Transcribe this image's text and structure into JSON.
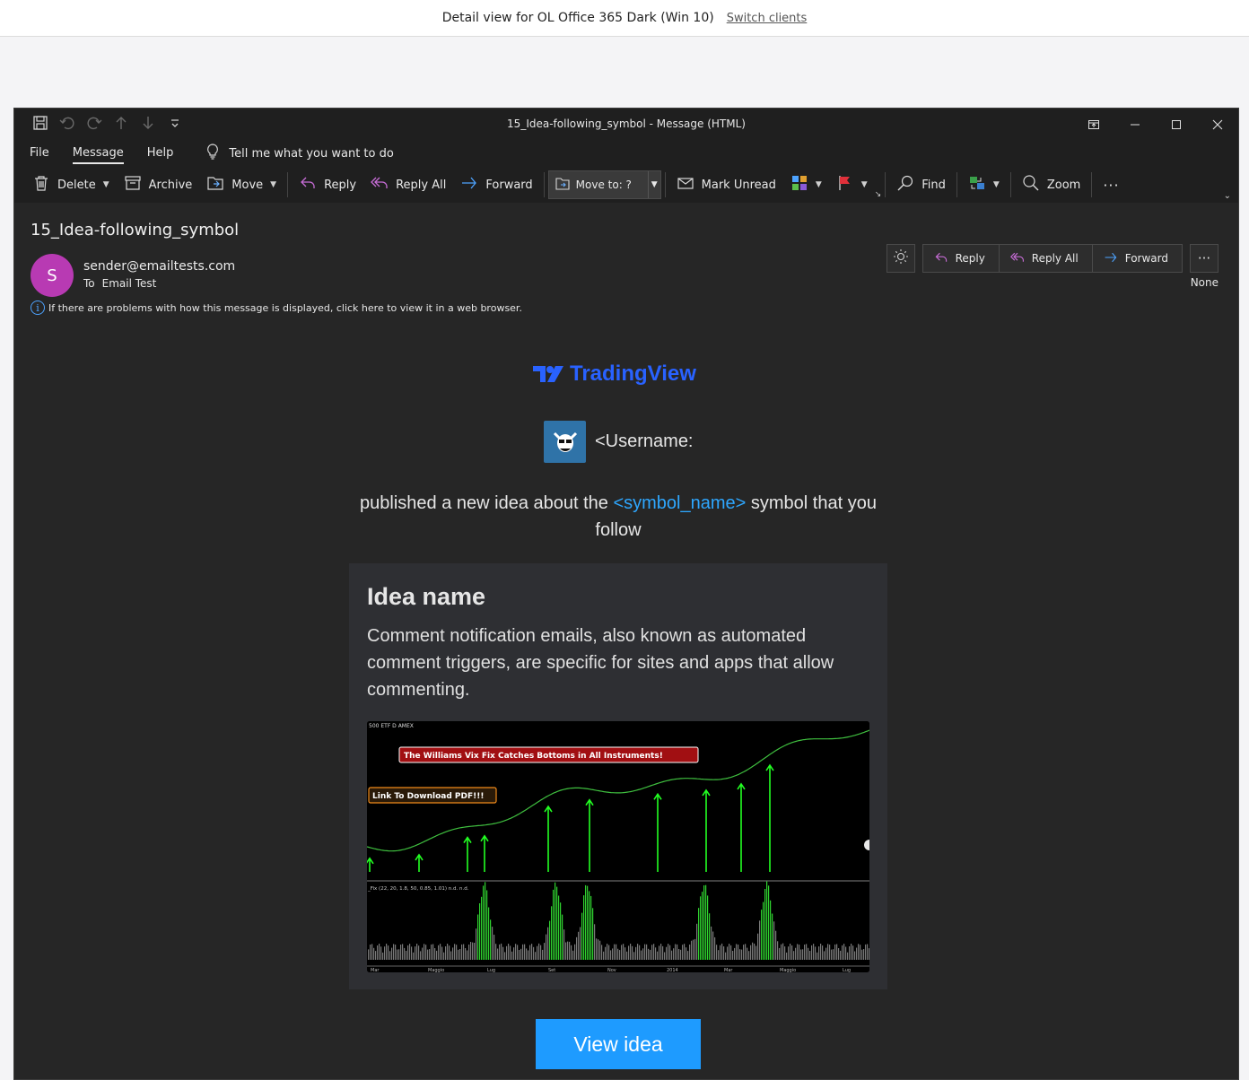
{
  "topbar": {
    "title": "Detail view for OL Office 365 Dark (Win 10)",
    "switch_label": "Switch clients"
  },
  "window": {
    "title": "15_Idea-following_symbol  -  Message (HTML)"
  },
  "menu": {
    "tabs": [
      "File",
      "Message",
      "Help"
    ],
    "active_tab": "Message",
    "tell_me": "Tell me what you want to do"
  },
  "ribbon": {
    "delete": "Delete",
    "archive": "Archive",
    "move": "Move",
    "reply": "Reply",
    "reply_all": "Reply All",
    "forward": "Forward",
    "move_to": "Move to: ?",
    "mark_unread": "Mark Unread",
    "find": "Find",
    "zoom": "Zoom"
  },
  "message": {
    "subject": "15_Idea-following_symbol",
    "avatar_initial": "S",
    "sender": "sender@emailtests.com",
    "to_label": "To",
    "to_value": "Email Test",
    "info": "If there are problems with how this message is displayed, click here to view it in a web browser.",
    "actions": {
      "reply": "Reply",
      "reply_all": "Reply All",
      "forward": "Forward"
    },
    "category": "None"
  },
  "email": {
    "brand": "TradingView",
    "username": "<Username:",
    "published_pre": "published a new idea about the ",
    "symbol": "<symbol_name>",
    "published_post": " symbol that you follow",
    "idea_title": "Idea name",
    "idea_desc": "Comment notification emails, also known as automated comment triggers, are specific for sites and apps that allow commenting.",
    "chart": {
      "header": "500 ETF  D  AMEX",
      "banner": "The Williams Vix Fix Catches Bottoms in All Instruments!",
      "link": "Link To Download PDF!!!",
      "indicator": "_Fix (22, 20, 1.8, 50, 0.85, 1.01)  n.d.  n.d.",
      "months": [
        "Mar",
        "Maggio",
        "Lug",
        "Set",
        "Nov",
        "2014",
        "Mar",
        "Maggio",
        "Lug"
      ]
    },
    "cta": "View idea"
  },
  "colors": {
    "accent_blue": "#2962ff",
    "link_blue": "#2ea7ff",
    "button_blue": "#1e9bff",
    "avatar_purple": "#b83ab3"
  }
}
